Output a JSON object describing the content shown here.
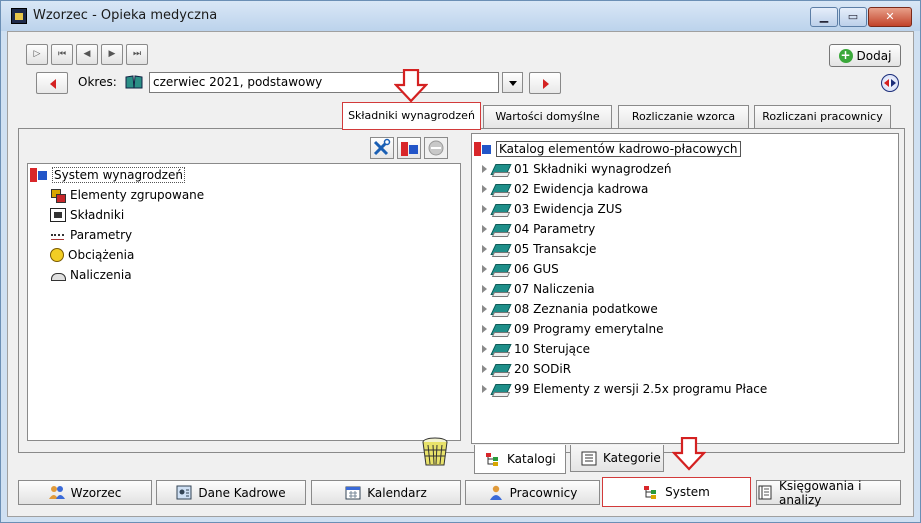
{
  "window": {
    "title": "Wzorzec - Opieka medyczna"
  },
  "toolbar": {
    "add_label": "Dodaj"
  },
  "okres": {
    "label": "Okres:",
    "value": "czerwiec 2021, podstawowy"
  },
  "top_tabs": [
    {
      "label": "Składniki wynagrodzeń",
      "active": true
    },
    {
      "label": "Wartości domyślne",
      "active": false
    },
    {
      "label": "Rozliczanie wzorca",
      "active": false
    },
    {
      "label": "Rozliczani pracownicy",
      "active": false
    }
  ],
  "left_tree": {
    "root": "System wynagrodzeń",
    "children": [
      "Elementy zgrupowane",
      "Składniki",
      "Parametry",
      "Obciążenia",
      "Naliczenia"
    ]
  },
  "right_tree": {
    "root": "Katalog elementów kadrowo-płacowych",
    "items": [
      "01 Składniki wynagrodzeń",
      "02 Ewidencja kadrowa",
      "03 Ewidencja ZUS",
      "04 Parametry",
      "05 Transakcje",
      "06 GUS",
      "07 Naliczenia",
      "08 Zeznania podatkowe",
      "09 Programy emerytalne",
      "10 Sterujące",
      "20 SODiR",
      "99 Elementy z wersji 2.5x programu Płace"
    ]
  },
  "bottom_tabs": [
    {
      "label": "Katalogi",
      "active": true
    },
    {
      "label": "Kategorie",
      "active": false
    }
  ],
  "modules": [
    {
      "label": "Wzorzec",
      "active": false
    },
    {
      "label": "Dane Kadrowe",
      "active": false
    },
    {
      "label": "Kalendarz",
      "active": false
    },
    {
      "label": "Pracownicy",
      "active": false
    },
    {
      "label": "System",
      "active": true
    },
    {
      "label": "Księgowania i analizy",
      "active": false
    }
  ],
  "colors": {
    "highlight_red": "#d23a3a",
    "title_bar": "#cfe0f2",
    "catalog_book": "#1f8f8a"
  }
}
